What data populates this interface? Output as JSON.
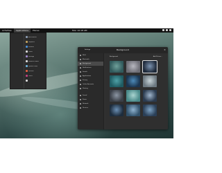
{
  "topbar": {
    "items": [
      "Activities",
      "Applications",
      "Places"
    ],
    "clock": "Mon 10:18 AM",
    "status_icons": [
      "network-icon",
      "volume-icon",
      "power-icon"
    ]
  },
  "app_menu": {
    "apps": [
      {
        "label": "Accessories",
        "color": "#8a9ab0"
      },
      {
        "label": "Graphics",
        "color": "#c0a060"
      },
      {
        "label": "Internet",
        "color": "#4a90d9"
      },
      {
        "label": "Office",
        "color": "#d9d9d9"
      },
      {
        "label": "Settings",
        "color": "#a08ad0"
      },
      {
        "label": "Sound & Video",
        "color": "#d9d9d9"
      },
      {
        "label": "System Tools",
        "color": "#6ab0d8"
      },
      {
        "label": "Utilities",
        "color": "#e06040"
      },
      {
        "label": "Other",
        "color": "#c04080"
      },
      {
        "label": "",
        "color": "#d9d9d9"
      }
    ]
  },
  "settings_window": {
    "left_title": "Settings",
    "title": "Background",
    "sidebar": [
      {
        "label": "Wi-Fi",
        "selected": false
      },
      {
        "label": "Bluetooth",
        "selected": false
      },
      {
        "label": "Background",
        "selected": true
      },
      {
        "label": "Notifications",
        "selected": false
      },
      {
        "label": "Search",
        "selected": false
      },
      {
        "label": "Applications",
        "selected": false
      },
      {
        "label": "Privacy",
        "selected": false
      },
      {
        "label": "Online Accounts",
        "selected": false
      },
      {
        "label": "Sharing",
        "selected": false
      },
      {
        "label": "Sound",
        "selected": false
      },
      {
        "label": "Power",
        "selected": false
      },
      {
        "label": "Network",
        "selected": false
      },
      {
        "label": "Devices",
        "selected": false
      }
    ],
    "content": {
      "header_left": "Background",
      "header_right": "Add Picture..."
    },
    "thumbnails": [
      {
        "name": "wallpaper-1",
        "bg": "#315a5c",
        "accent": "#6fa09a",
        "selected": false
      },
      {
        "name": "wallpaper-2",
        "bg": "#6e6e76",
        "accent": "#b8b8c0",
        "selected": false
      },
      {
        "name": "wallpaper-3",
        "bg": "#1f2a3a",
        "accent": "#7c93b0",
        "selected": true
      },
      {
        "name": "wallpaper-4",
        "bg": "#1f5b62",
        "accent": "#4fa0a6",
        "selected": false
      },
      {
        "name": "wallpaper-5",
        "bg": "#1b3550",
        "accent": "#4d8ab8",
        "selected": false
      },
      {
        "name": "wallpaper-6",
        "bg": "#6c7880",
        "accent": "#c8d4d8",
        "selected": false
      },
      {
        "name": "wallpaper-7",
        "bg": "#3a3f47",
        "accent": "#8c96a4",
        "selected": false
      },
      {
        "name": "wallpaper-8",
        "bg": "#4a8a8a",
        "accent": "#a9d4d0",
        "selected": false
      },
      {
        "name": "wallpaper-9",
        "bg": "#2b3b4f",
        "accent": "#9fb5cc",
        "selected": false
      },
      {
        "name": "wallpaper-10",
        "bg": "#1d2c3c",
        "accent": "#6a8fb4",
        "selected": false
      },
      {
        "name": "wallpaper-11",
        "bg": "#31516a",
        "accent": "#8fb3cf",
        "selected": false
      },
      {
        "name": "wallpaper-12",
        "bg": "#2a3f57",
        "accent": "#7da3c4",
        "selected": false
      }
    ]
  }
}
